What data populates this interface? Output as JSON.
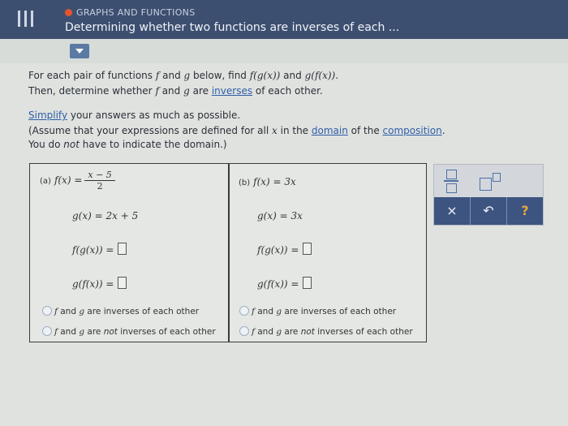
{
  "header": {
    "breadcrumb": "GRAPHS AND FUNCTIONS",
    "title": "Determining whether two functions are inverses of each ..."
  },
  "instructions": {
    "line1": [
      "For each pair of functions ",
      "f",
      " and ",
      "g",
      " below, find ",
      "f(g(x))",
      " and ",
      "g(f(x))",
      "."
    ],
    "line2": [
      "Then, determine whether ",
      "f",
      " and ",
      "g",
      " are ",
      "inverses",
      " of each other."
    ],
    "simplify_link": "Simplify",
    "simplify_rest": " your answers as much as possible.",
    "assume_a": "(Assume that your expressions are defined for all ",
    "assume_x": "x",
    "assume_b": " in the ",
    "domain_link": "domain",
    "assume_c": " of the ",
    "composition_link": "composition",
    "assume_d": ".",
    "notice_a": "You do ",
    "notice_not": "not",
    "notice_b": " have to indicate the domain.)"
  },
  "part_a": {
    "label": "(a)",
    "f_lhs": "f(x) =",
    "f_num": "x − 5",
    "f_den": "2",
    "g_def": "g(x) = 2x + 5",
    "fg_lhs": "f(g(x)) =",
    "gf_lhs": "g(f(x)) =",
    "opt1": [
      "f",
      " and ",
      "g",
      " are inverses of each other"
    ],
    "opt2": [
      "f",
      " and ",
      "g",
      " are ",
      "not",
      " inverses of each other"
    ]
  },
  "part_b": {
    "label": "(b)",
    "f_def": "f(x) = 3x",
    "g_def": "g(x) = 3x",
    "fg_lhs": "f(g(x)) =",
    "gf_lhs": "g(f(x)) =",
    "opt1": [
      "f",
      " and ",
      "g",
      " are inverses of each other"
    ],
    "opt2": [
      "f",
      " and ",
      "g",
      " are ",
      "not",
      " inverses of each other"
    ]
  },
  "toolbox": {
    "clear": "×",
    "undo": "↶",
    "help": "?"
  }
}
